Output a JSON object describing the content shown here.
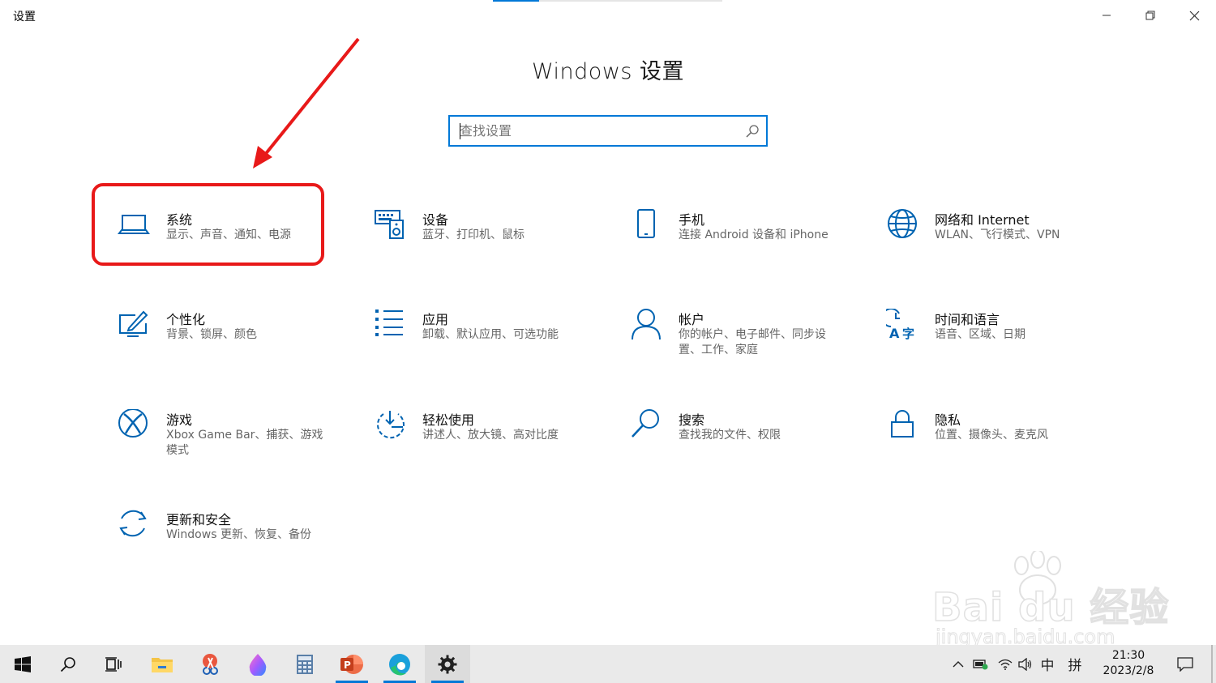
{
  "window": {
    "title": "设置",
    "controls": {
      "minimize": "minimize-icon",
      "restore": "restore-icon",
      "close": "close-icon"
    }
  },
  "header": {
    "title": "Windows 设置"
  },
  "search": {
    "placeholder": "查找设置",
    "value": ""
  },
  "tiles": [
    {
      "id": "system",
      "name": "系统",
      "desc": "显示、声音、通知、电源",
      "icon": "laptop-icon"
    },
    {
      "id": "devices",
      "name": "设备",
      "desc": "蓝牙、打印机、鼠标",
      "icon": "keyboard-speaker-icon"
    },
    {
      "id": "phone",
      "name": "手机",
      "desc": "连接 Android 设备和 iPhone",
      "icon": "phone-icon"
    },
    {
      "id": "network",
      "name": "网络和 Internet",
      "desc": "WLAN、飞行模式、VPN",
      "icon": "globe-icon"
    },
    {
      "id": "personalization",
      "name": "个性化",
      "desc": "背景、锁屏、颜色",
      "icon": "pen-monitor-icon"
    },
    {
      "id": "apps",
      "name": "应用",
      "desc": "卸载、默认应用、可选功能",
      "icon": "app-list-icon"
    },
    {
      "id": "accounts",
      "name": "帐户",
      "desc": "你的帐户、电子邮件、同步设置、工作、家庭",
      "icon": "person-icon"
    },
    {
      "id": "time-language",
      "name": "时间和语言",
      "desc": "语音、区域、日期",
      "icon": "clock-language-icon"
    },
    {
      "id": "gaming",
      "name": "游戏",
      "desc": "Xbox Game Bar、捕获、游戏模式",
      "icon": "xbox-icon"
    },
    {
      "id": "ease-of-access",
      "name": "轻松使用",
      "desc": "讲述人、放大镜、高对比度",
      "icon": "ease-of-access-icon"
    },
    {
      "id": "search",
      "name": "搜索",
      "desc": "查找我的文件、权限",
      "icon": "magnifier-icon"
    },
    {
      "id": "privacy",
      "name": "隐私",
      "desc": "位置、摄像头、麦克风",
      "icon": "lock-icon"
    },
    {
      "id": "update-security",
      "name": "更新和安全",
      "desc": "Windows 更新、恢复、备份",
      "icon": "sync-icon"
    }
  ],
  "annotation": {
    "highlighted_tile": "system",
    "color": "#e81919"
  },
  "watermark": {
    "main": "Bai du 经验",
    "sub": "jingyan.baidu.com"
  },
  "taskbar": {
    "apps": [
      "start-icon",
      "search-icon",
      "task-view-icon",
      "file-explorer-icon",
      "snipping-icon",
      "paint-icon",
      "calculator-icon",
      "powerpoint-icon",
      "edge-icon",
      "settings-icon"
    ],
    "active_app": "settings-icon",
    "ime_lang": "中",
    "ime_mode": "拼",
    "time": "21:30",
    "date": "2023/2/8"
  },
  "colors": {
    "accent": "#0078d7",
    "icon": "#0063b1",
    "annotation": "#e81919",
    "taskbar": "#eaeaea"
  }
}
